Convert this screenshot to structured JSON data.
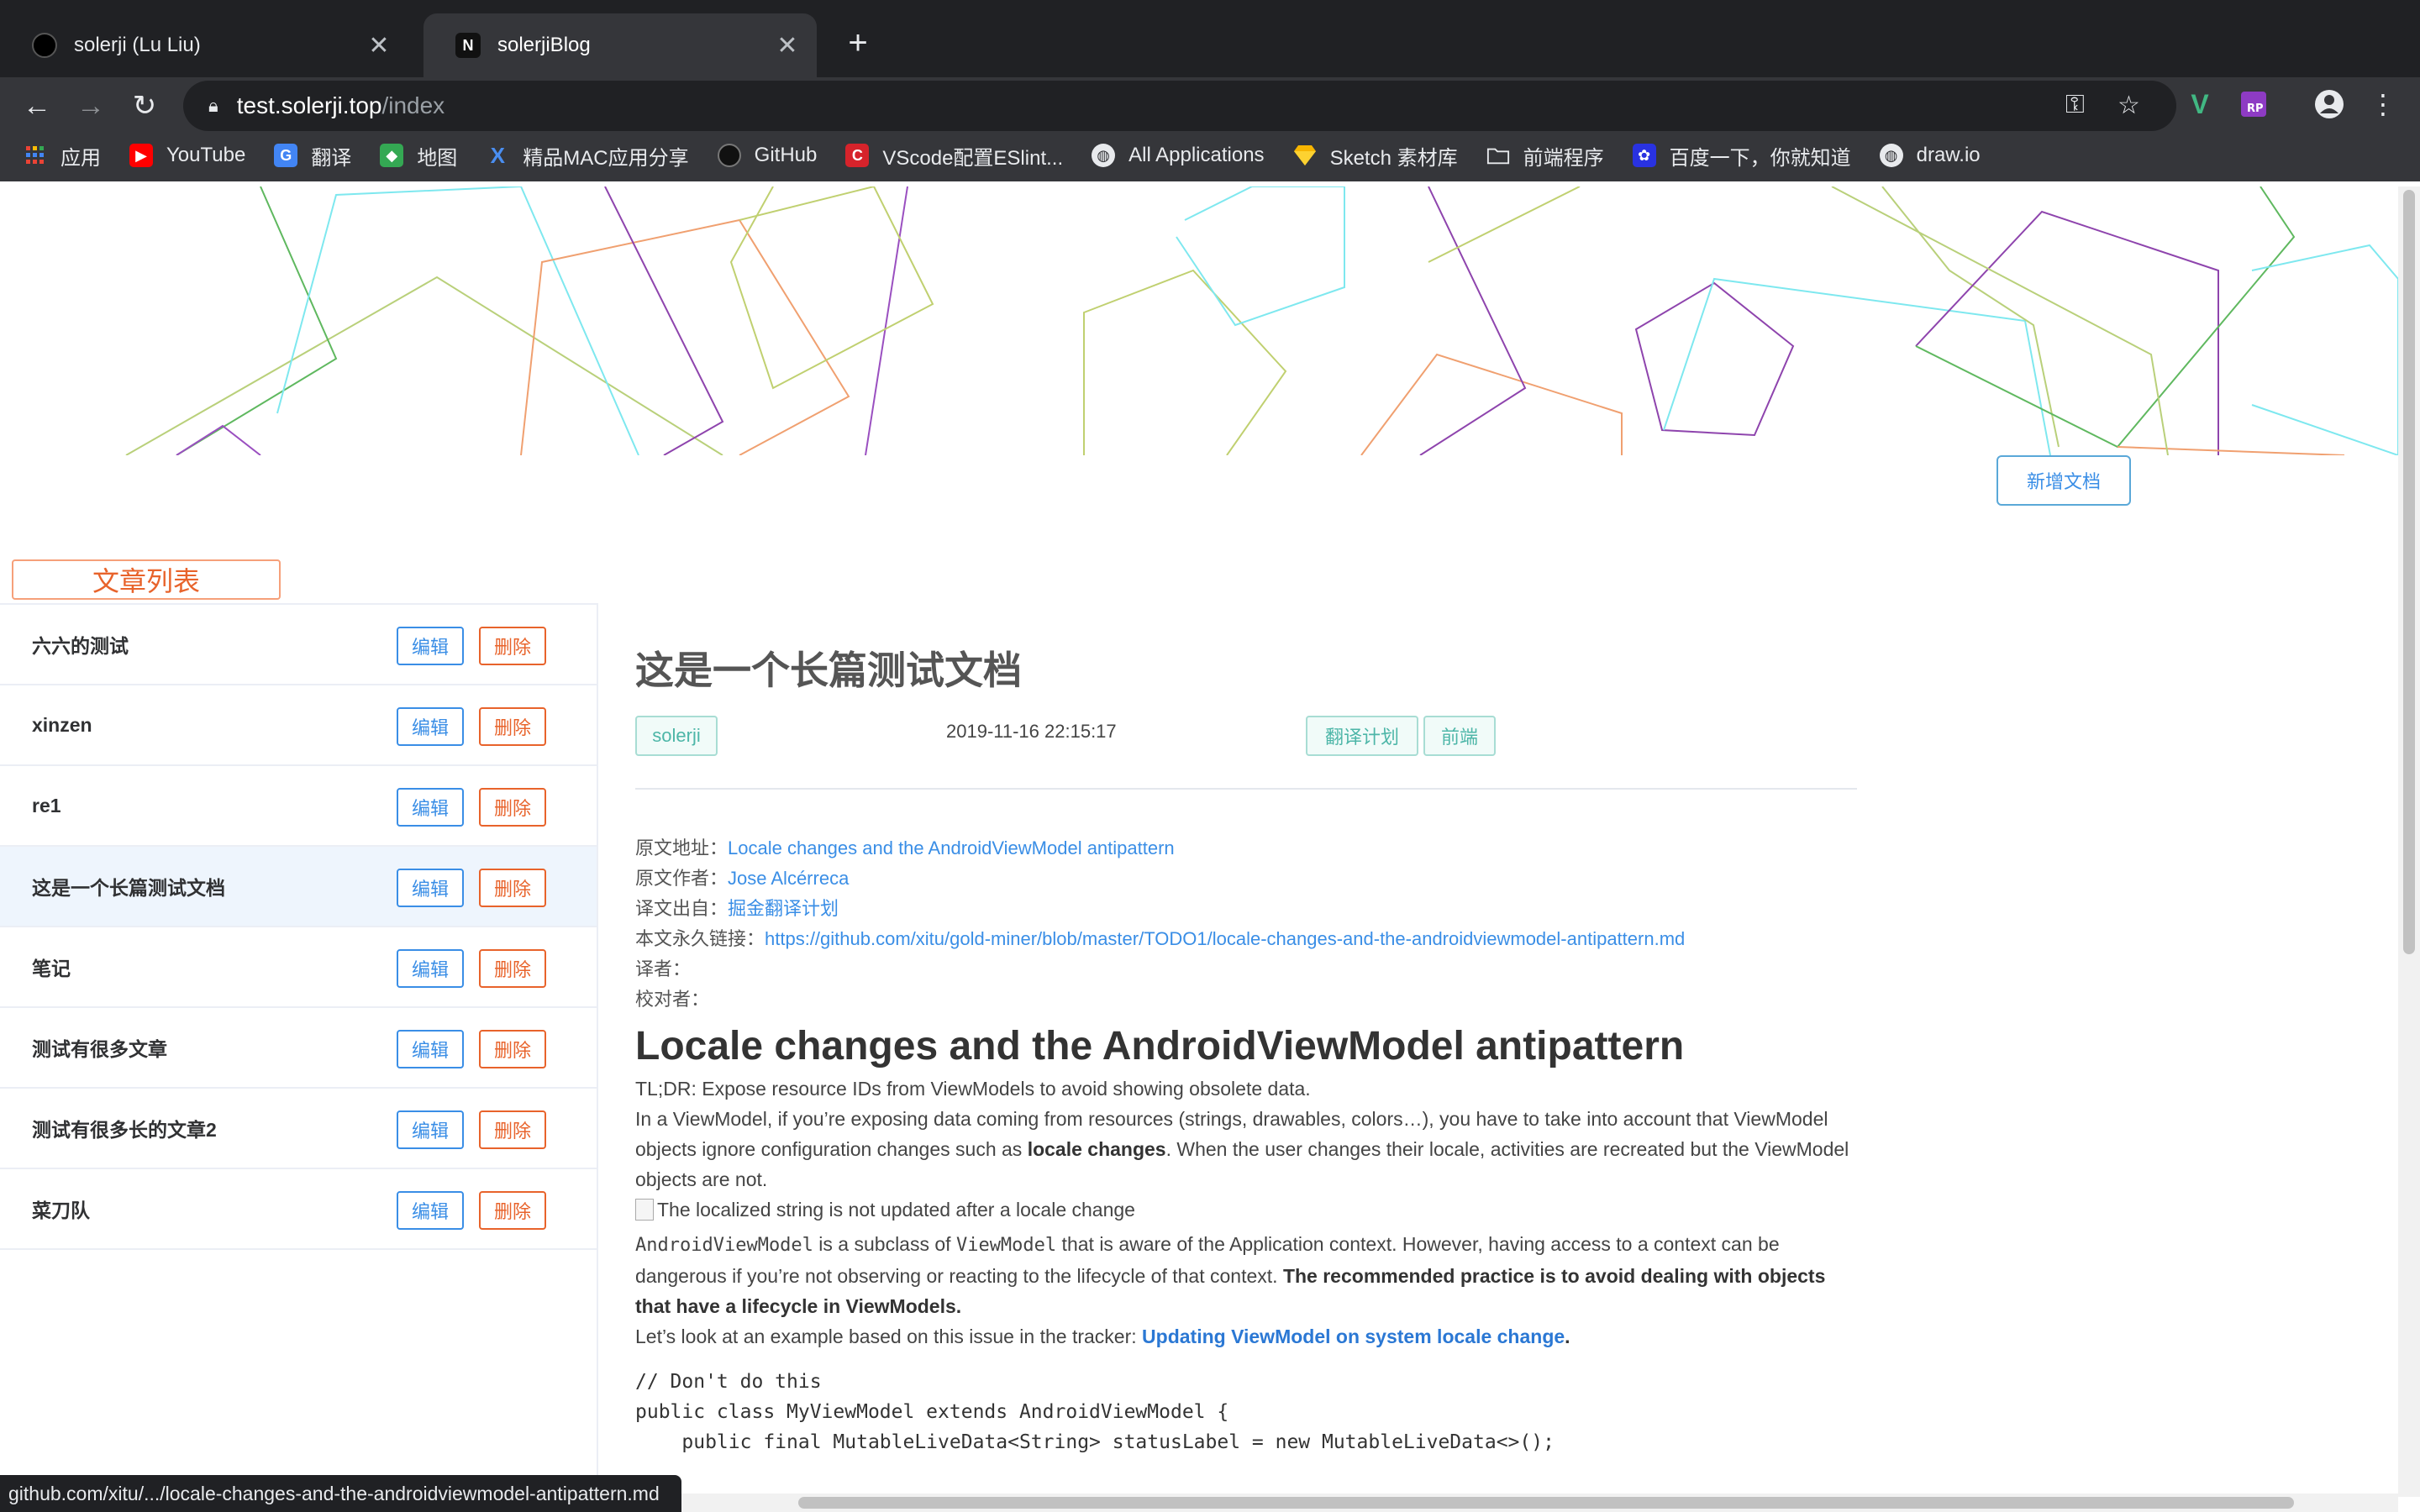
{
  "browser": {
    "tabs": [
      {
        "title": "solerji (Lu Liu)",
        "favicon": "github-icon"
      },
      {
        "title": "solerjiBlog",
        "favicon": "n-icon"
      }
    ],
    "new_tab": "+",
    "close": "✕",
    "url_host": "test.solerji.top",
    "url_path": "/index",
    "bookmarks": [
      {
        "label": "应用",
        "icon": "apps-grid-icon"
      },
      {
        "label": "YouTube",
        "icon": "youtube-icon"
      },
      {
        "label": "翻译",
        "icon": "translate-icon"
      },
      {
        "label": "地图",
        "icon": "maps-icon"
      },
      {
        "label": "精品MAC应用分享",
        "icon": "x-icon"
      },
      {
        "label": "GitHub",
        "icon": "github-icon"
      },
      {
        "label": "VScode配置ESlint...",
        "icon": "c-icon"
      },
      {
        "label": "All Applications",
        "icon": "globe-icon"
      },
      {
        "label": "Sketch 素材库",
        "icon": "sketch-icon"
      },
      {
        "label": "前端程序",
        "icon": "folder-icon"
      },
      {
        "label": "百度一下，你就知道",
        "icon": "baidu-icon"
      },
      {
        "label": "draw.io",
        "icon": "globe-icon"
      }
    ]
  },
  "page": {
    "add_doc_button": "新增文档",
    "list_title": "文章列表",
    "edit_label": "编辑",
    "delete_label": "删除",
    "articles": [
      {
        "title": "六六的测试",
        "selected": false
      },
      {
        "title": "xinzen",
        "selected": false
      },
      {
        "title": "re1",
        "selected": false
      },
      {
        "title": "这是一个长篇测试文档",
        "selected": true
      },
      {
        "title": "笔记",
        "selected": false
      },
      {
        "title": "测试有很多文章",
        "selected": false
      },
      {
        "title": "测试有很多长的文章2",
        "selected": false
      },
      {
        "title": "菜刀队",
        "selected": false
      }
    ],
    "detail": {
      "title": "这是一个长篇测试文档",
      "author": "solerji",
      "date": "2019-11-16 22:15:17",
      "tags": [
        "翻译计划",
        "前端"
      ],
      "original_url_label": "原文地址：",
      "original_url_text": "Locale changes and the AndroidViewModel antipattern",
      "original_author_label": "原文作者：",
      "original_author": "Jose Alcérreca",
      "source_label": "译文出自：",
      "source": "掘金翻译计划",
      "permalink_label": "本文永久链接：",
      "permalink": "https://github.com/xitu/gold-miner/blob/master/TODO1/locale-changes-and-the-androidviewmodel-antipattern.md",
      "translator_label": "译者：",
      "proofreader_label": "校对者：",
      "heading": "Locale changes and the AndroidViewModel antipattern",
      "p1": "TL;DR: Expose resource IDs from ViewModels to avoid showing obsolete data.",
      "p2a": "In a ViewModel, if you’re exposing data coming from resources (strings, drawables, colors…), you have to take into account that ViewModel objects ignore configuration changes such as ",
      "p2b": "locale changes",
      "p2c": ". When the user changes their locale, activities are recreated but the ViewModel objects are not.",
      "img_alt": "The localized string is not updated after a locale change",
      "p3code1": "AndroidViewModel",
      "p3a": " is a subclass of ",
      "p3code2": "ViewModel",
      "p3b": " that is aware of the Application context. However, having access to a context can be dangerous if you’re not observing or reacting to the lifecycle of that context. ",
      "p3bold": "The recommended practice is to avoid dealing with objects that have a lifecycle in ViewModels.",
      "p4a": "Let’s look at an example based on this issue in the tracker: ",
      "p4link": "Updating ViewModel on system locale change",
      "p4b": ".",
      "code": "// Don't do this\npublic class MyViewModel extends AndroidViewModel {\n    public final MutableLiveData<String> statusLabel = new MutableLiveData<>();"
    }
  },
  "status_bar": "github.com/xitu/.../locale-changes-and-the-androidviewmodel-antipattern.md"
}
